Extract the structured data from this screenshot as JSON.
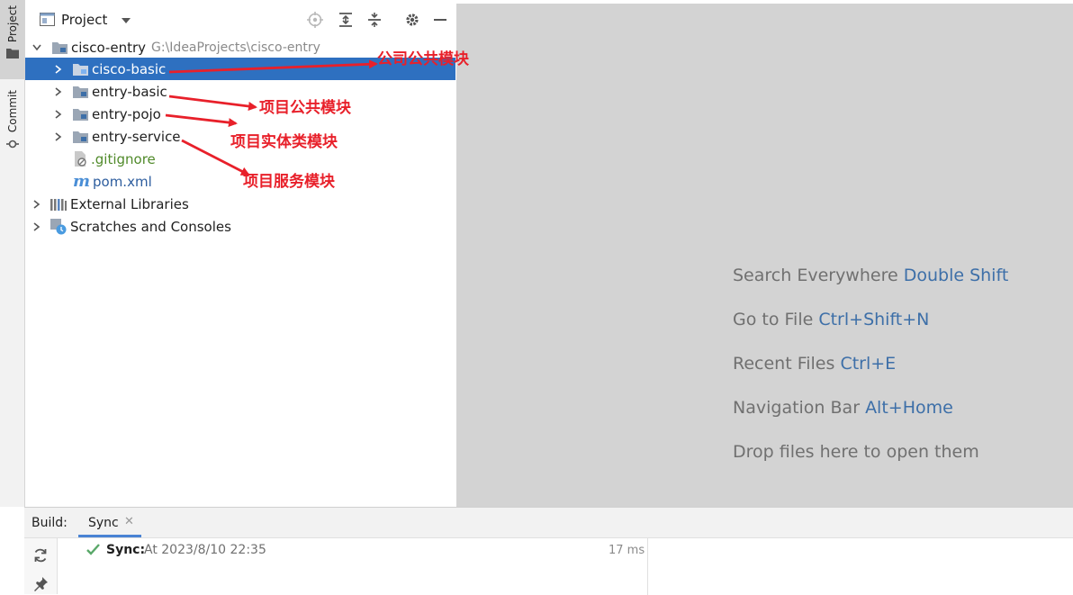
{
  "left_tool_strip": {
    "project_tab": "Project",
    "commit_tab": "Commit"
  },
  "project_panel": {
    "title": "Project",
    "tree": {
      "root_name": "cisco-entry",
      "root_path": "G:\\IdeaProjects\\cisco-entry",
      "modules": [
        "cisco-basic",
        "entry-basic",
        "entry-pojo",
        "entry-service"
      ],
      "files": [
        ".gitignore",
        "pom.xml"
      ],
      "external_libraries": "External Libraries",
      "scratches": "Scratches and Consoles"
    }
  },
  "annotations": [
    "公司公共模块",
    "项目公共模块",
    "项目实体类模块",
    "项目服务模块"
  ],
  "editor_hints": [
    {
      "text": "Search Everywhere",
      "shortcut": "Double Shift"
    },
    {
      "text": "Go to File",
      "shortcut": "Ctrl+Shift+N"
    },
    {
      "text": "Recent Files",
      "shortcut": "Ctrl+E"
    },
    {
      "text": "Navigation Bar",
      "shortcut": "Alt+Home"
    },
    {
      "text": "Drop files here to open them",
      "shortcut": ""
    }
  ],
  "build": {
    "label": "Build:",
    "tab": "Sync",
    "status_label": "Sync:",
    "status_time": "At 2023/8/10 22:35",
    "duration": "17 ms"
  },
  "colors": {
    "selection": "#2e70c0",
    "annotation": "#e8202a",
    "shortcut": "#3d6fa8",
    "gitignore_text": "#508a2a",
    "success": "#59a869"
  }
}
